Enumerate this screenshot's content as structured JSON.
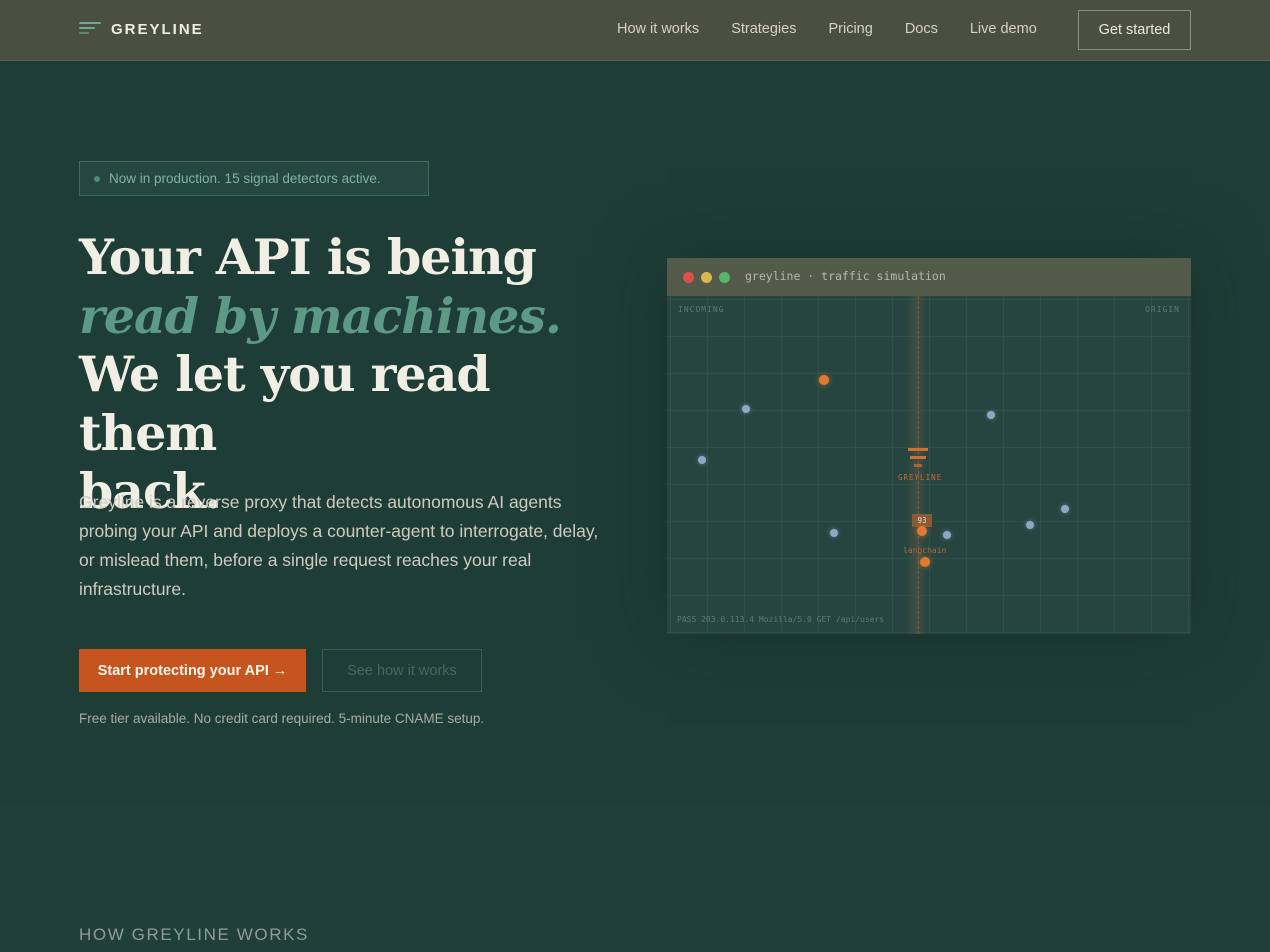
{
  "brand": {
    "name": "GREYLINE",
    "accent": "#6fa995"
  },
  "nav": {
    "links": [
      "How it works",
      "Strategies",
      "Pricing",
      "Docs",
      "Live demo"
    ],
    "cta": "Get started"
  },
  "hero": {
    "badge": "Now in production. 15 signal detectors active.",
    "headline": {
      "line1": "Your API is being",
      "accent": "read by machines.",
      "line3": "We let you read them",
      "line4": "back."
    },
    "description": "Greyline is a reverse proxy that detects autonomous AI agents probing your API and deploys a counter-agent to interrogate, delay, or mislead them, before a single request reaches your real infrastructure.",
    "primary_cta": "Start protecting your API →",
    "secondary_cta": "See how it works",
    "fine_print": "Free tier available. No credit card required. 5-minute CNAME setup."
  },
  "terminal": {
    "title": "greyline · traffic simulation",
    "label_left": "INCOMING",
    "label_right": "ORIGIN",
    "center_label": "GREYLINE",
    "score": "93",
    "agent_label": "langchain",
    "log": "PASS   203.0.113.4  Mozilla/5.0  GET /api/users"
  },
  "section": {
    "label": "HOW GREYLINE WORKS"
  },
  "colors": {
    "background": "#1f3d37",
    "nav": "#4a4f40",
    "primary_button": "#c5541f",
    "agent_dot": "#e07a30",
    "human_dot": "#8ea7c4"
  }
}
